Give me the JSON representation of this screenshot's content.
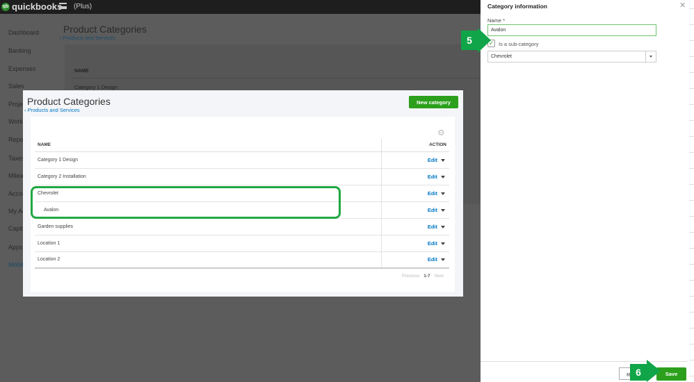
{
  "topbar": {
    "logo": "quickbooks",
    "logo_badge": "qb",
    "company": "(Plus)"
  },
  "sidebar": {
    "items": [
      "Dashboard",
      "Banking",
      "Expenses",
      "Sales",
      "Projects",
      "Workers",
      "Reports",
      "Taxes",
      "Mileage",
      "Accounting",
      "My Accountant",
      "Capital",
      "Apps",
      "Mobile"
    ]
  },
  "background_page": {
    "title": "Product Categories",
    "back_link": "Products and Services",
    "table_header": "NAME",
    "first_row": "Category 1 Design"
  },
  "modal": {
    "title": "Product Categories",
    "back_link": "Products and Services",
    "new_button": "New category",
    "columns": {
      "name": "NAME",
      "action": "ACTION"
    },
    "rows": [
      {
        "name": "Category 1 Design",
        "action": "Edit"
      },
      {
        "name": "Category 2 Installation",
        "action": "Edit"
      },
      {
        "name": "Chevrolet",
        "action": "Edit"
      },
      {
        "name": "Avalon",
        "action": "Edit"
      },
      {
        "name": "Garden supplies",
        "action": "Edit"
      },
      {
        "name": "Location 1",
        "action": "Edit"
      },
      {
        "name": "Location 2",
        "action": "Edit"
      }
    ],
    "pager": {
      "previous": "Previous",
      "range": "1-7",
      "next": "Next"
    }
  },
  "panel": {
    "title": "Category information",
    "name_label": "Name *",
    "name_value": "Avalon",
    "subcategory_label": "Is a sub-category",
    "subcategory_checked": true,
    "parent_value": "Chevrolet",
    "revert_button": "Revert",
    "save_button": "Save"
  },
  "steps": {
    "step5": "5",
    "step6": "6"
  },
  "colors": {
    "accent_green": "#2ca01c",
    "link_blue": "#0077c5",
    "step_green": "#10a548"
  }
}
